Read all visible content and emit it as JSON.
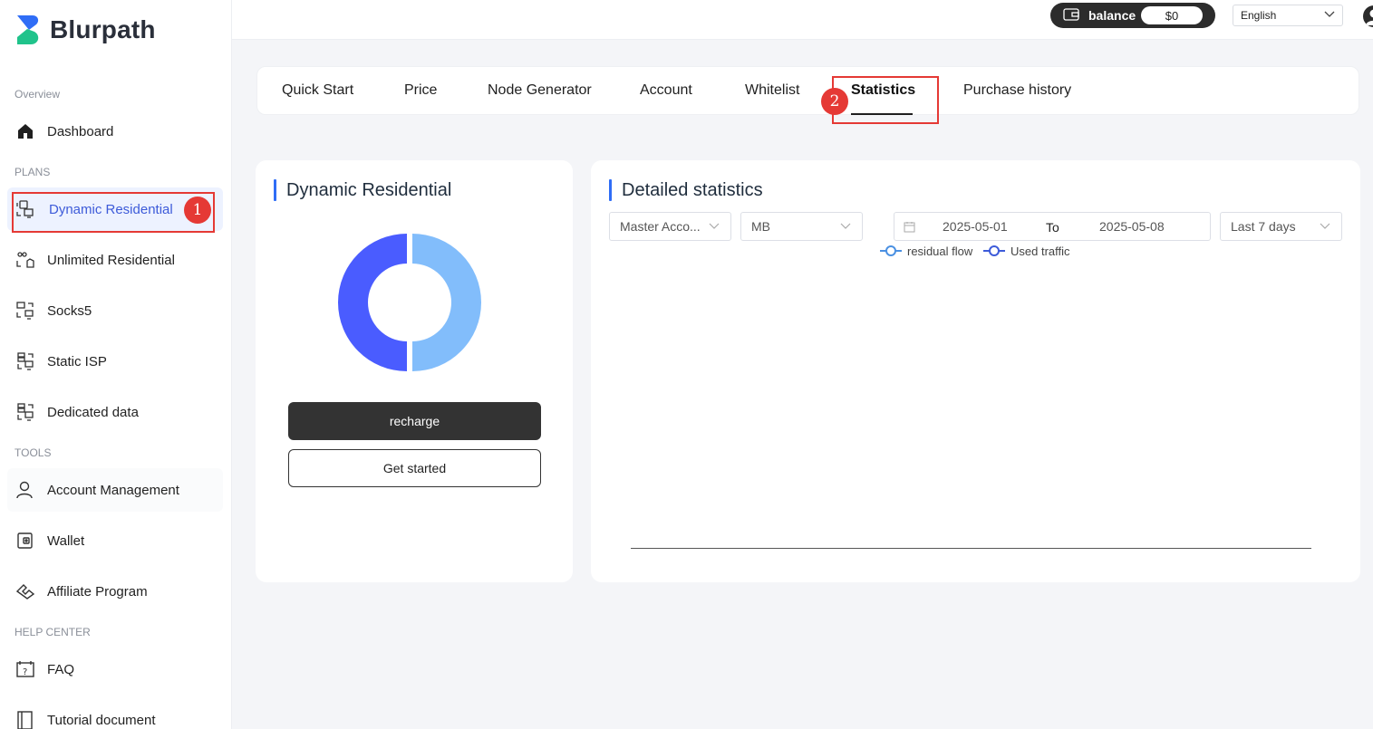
{
  "brand": {
    "name": "Blurpath"
  },
  "sidebar": {
    "sections": {
      "overview": "Overview",
      "plans": "PLANS",
      "tools": "TOOLS",
      "help": "HELP CENTER"
    },
    "items": [
      {
        "label": "Dashboard",
        "icon": "home-icon"
      },
      {
        "label": "Dynamic Residential",
        "icon": "dynamic-residential-icon",
        "active": true
      },
      {
        "label": "Unlimited Residential",
        "icon": "unlimited-residential-icon"
      },
      {
        "label": "Socks5",
        "icon": "socks5-icon"
      },
      {
        "label": "Static ISP",
        "icon": "static-isp-icon"
      },
      {
        "label": "Dedicated data",
        "icon": "dedicated-data-icon"
      },
      {
        "label": "Account Management",
        "icon": "user-icon"
      },
      {
        "label": "Wallet",
        "icon": "wallet-icon"
      },
      {
        "label": "Affiliate Program",
        "icon": "handshake-icon"
      },
      {
        "label": "FAQ",
        "icon": "faq-icon"
      },
      {
        "label": "Tutorial document",
        "icon": "document-icon"
      }
    ]
  },
  "header": {
    "balance_label": "balance",
    "balance_value": "$0",
    "language": "English"
  },
  "tabs": [
    {
      "label": "Quick Start"
    },
    {
      "label": "Price"
    },
    {
      "label": "Node Generator"
    },
    {
      "label": "Account"
    },
    {
      "label": "Whitelist"
    },
    {
      "label": "Statistics",
      "active": true
    },
    {
      "label": "Purchase history"
    }
  ],
  "annotations": {
    "badge1": "1",
    "badge2": "2"
  },
  "plan_card": {
    "title": "Dynamic Residential",
    "recharge_label": "recharge",
    "get_started_label": "Get started",
    "donut": {
      "segments": [
        {
          "color": "#4a5cff",
          "share": 0.5
        },
        {
          "color": "#82bdfb",
          "share": 0.5
        }
      ]
    }
  },
  "stats_card": {
    "title": "Detailed statistics",
    "account_select": "Master Acco...",
    "unit_select": "MB",
    "date_start": "2025-05-01",
    "date_to": "To",
    "date_end": "2025-05-08",
    "range_select": "Last 7 days",
    "legend": [
      {
        "label": "residual flow",
        "color": "#4a90e2"
      },
      {
        "label": "Used traffic",
        "color": "#3d5bd9"
      }
    ]
  },
  "colors": {
    "accent": "#2f6df6",
    "active_nav_bg": "#edf2ff",
    "active_nav_text": "#3d5bd9",
    "annotation": "#e53935"
  }
}
